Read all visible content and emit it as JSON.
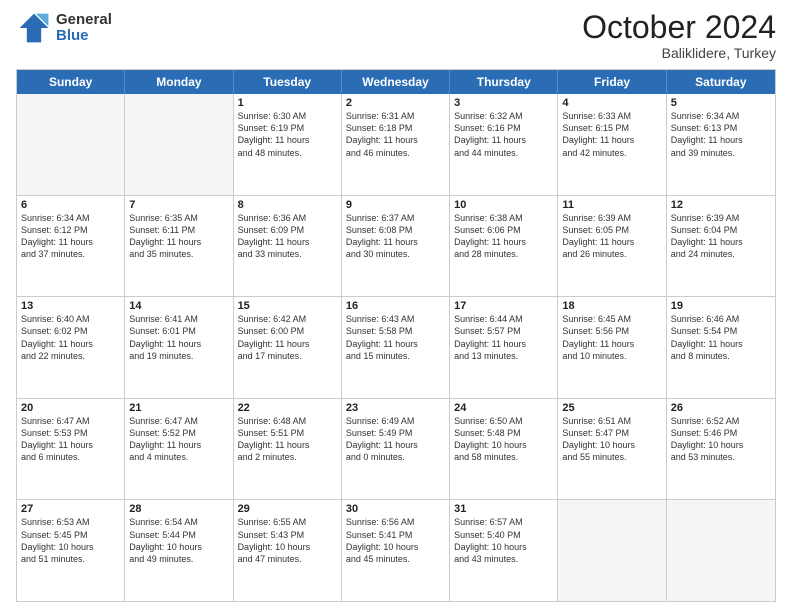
{
  "header": {
    "logo": {
      "general": "General",
      "blue": "Blue"
    },
    "title": "October 2024",
    "subtitle": "Baliklidere, Turkey"
  },
  "weekdays": [
    "Sunday",
    "Monday",
    "Tuesday",
    "Wednesday",
    "Thursday",
    "Friday",
    "Saturday"
  ],
  "rows": [
    [
      {
        "day": "",
        "empty": true,
        "detail": ""
      },
      {
        "day": "",
        "empty": true,
        "detail": ""
      },
      {
        "day": "1",
        "detail": "Sunrise: 6:30 AM\nSunset: 6:19 PM\nDaylight: 11 hours\nand 48 minutes."
      },
      {
        "day": "2",
        "detail": "Sunrise: 6:31 AM\nSunset: 6:18 PM\nDaylight: 11 hours\nand 46 minutes."
      },
      {
        "day": "3",
        "detail": "Sunrise: 6:32 AM\nSunset: 6:16 PM\nDaylight: 11 hours\nand 44 minutes."
      },
      {
        "day": "4",
        "detail": "Sunrise: 6:33 AM\nSunset: 6:15 PM\nDaylight: 11 hours\nand 42 minutes."
      },
      {
        "day": "5",
        "detail": "Sunrise: 6:34 AM\nSunset: 6:13 PM\nDaylight: 11 hours\nand 39 minutes."
      }
    ],
    [
      {
        "day": "6",
        "detail": "Sunrise: 6:34 AM\nSunset: 6:12 PM\nDaylight: 11 hours\nand 37 minutes."
      },
      {
        "day": "7",
        "detail": "Sunrise: 6:35 AM\nSunset: 6:11 PM\nDaylight: 11 hours\nand 35 minutes."
      },
      {
        "day": "8",
        "detail": "Sunrise: 6:36 AM\nSunset: 6:09 PM\nDaylight: 11 hours\nand 33 minutes."
      },
      {
        "day": "9",
        "detail": "Sunrise: 6:37 AM\nSunset: 6:08 PM\nDaylight: 11 hours\nand 30 minutes."
      },
      {
        "day": "10",
        "detail": "Sunrise: 6:38 AM\nSunset: 6:06 PM\nDaylight: 11 hours\nand 28 minutes."
      },
      {
        "day": "11",
        "detail": "Sunrise: 6:39 AM\nSunset: 6:05 PM\nDaylight: 11 hours\nand 26 minutes."
      },
      {
        "day": "12",
        "detail": "Sunrise: 6:39 AM\nSunset: 6:04 PM\nDaylight: 11 hours\nand 24 minutes."
      }
    ],
    [
      {
        "day": "13",
        "detail": "Sunrise: 6:40 AM\nSunset: 6:02 PM\nDaylight: 11 hours\nand 22 minutes."
      },
      {
        "day": "14",
        "detail": "Sunrise: 6:41 AM\nSunset: 6:01 PM\nDaylight: 11 hours\nand 19 minutes."
      },
      {
        "day": "15",
        "detail": "Sunrise: 6:42 AM\nSunset: 6:00 PM\nDaylight: 11 hours\nand 17 minutes."
      },
      {
        "day": "16",
        "detail": "Sunrise: 6:43 AM\nSunset: 5:58 PM\nDaylight: 11 hours\nand 15 minutes."
      },
      {
        "day": "17",
        "detail": "Sunrise: 6:44 AM\nSunset: 5:57 PM\nDaylight: 11 hours\nand 13 minutes."
      },
      {
        "day": "18",
        "detail": "Sunrise: 6:45 AM\nSunset: 5:56 PM\nDaylight: 11 hours\nand 10 minutes."
      },
      {
        "day": "19",
        "detail": "Sunrise: 6:46 AM\nSunset: 5:54 PM\nDaylight: 11 hours\nand 8 minutes."
      }
    ],
    [
      {
        "day": "20",
        "detail": "Sunrise: 6:47 AM\nSunset: 5:53 PM\nDaylight: 11 hours\nand 6 minutes."
      },
      {
        "day": "21",
        "detail": "Sunrise: 6:47 AM\nSunset: 5:52 PM\nDaylight: 11 hours\nand 4 minutes."
      },
      {
        "day": "22",
        "detail": "Sunrise: 6:48 AM\nSunset: 5:51 PM\nDaylight: 11 hours\nand 2 minutes."
      },
      {
        "day": "23",
        "detail": "Sunrise: 6:49 AM\nSunset: 5:49 PM\nDaylight: 11 hours\nand 0 minutes."
      },
      {
        "day": "24",
        "detail": "Sunrise: 6:50 AM\nSunset: 5:48 PM\nDaylight: 10 hours\nand 58 minutes."
      },
      {
        "day": "25",
        "detail": "Sunrise: 6:51 AM\nSunset: 5:47 PM\nDaylight: 10 hours\nand 55 minutes."
      },
      {
        "day": "26",
        "detail": "Sunrise: 6:52 AM\nSunset: 5:46 PM\nDaylight: 10 hours\nand 53 minutes."
      }
    ],
    [
      {
        "day": "27",
        "detail": "Sunrise: 6:53 AM\nSunset: 5:45 PM\nDaylight: 10 hours\nand 51 minutes."
      },
      {
        "day": "28",
        "detail": "Sunrise: 6:54 AM\nSunset: 5:44 PM\nDaylight: 10 hours\nand 49 minutes."
      },
      {
        "day": "29",
        "detail": "Sunrise: 6:55 AM\nSunset: 5:43 PM\nDaylight: 10 hours\nand 47 minutes."
      },
      {
        "day": "30",
        "detail": "Sunrise: 6:56 AM\nSunset: 5:41 PM\nDaylight: 10 hours\nand 45 minutes."
      },
      {
        "day": "31",
        "detail": "Sunrise: 6:57 AM\nSunset: 5:40 PM\nDaylight: 10 hours\nand 43 minutes."
      },
      {
        "day": "",
        "empty": true,
        "detail": ""
      },
      {
        "day": "",
        "empty": true,
        "detail": ""
      }
    ]
  ]
}
